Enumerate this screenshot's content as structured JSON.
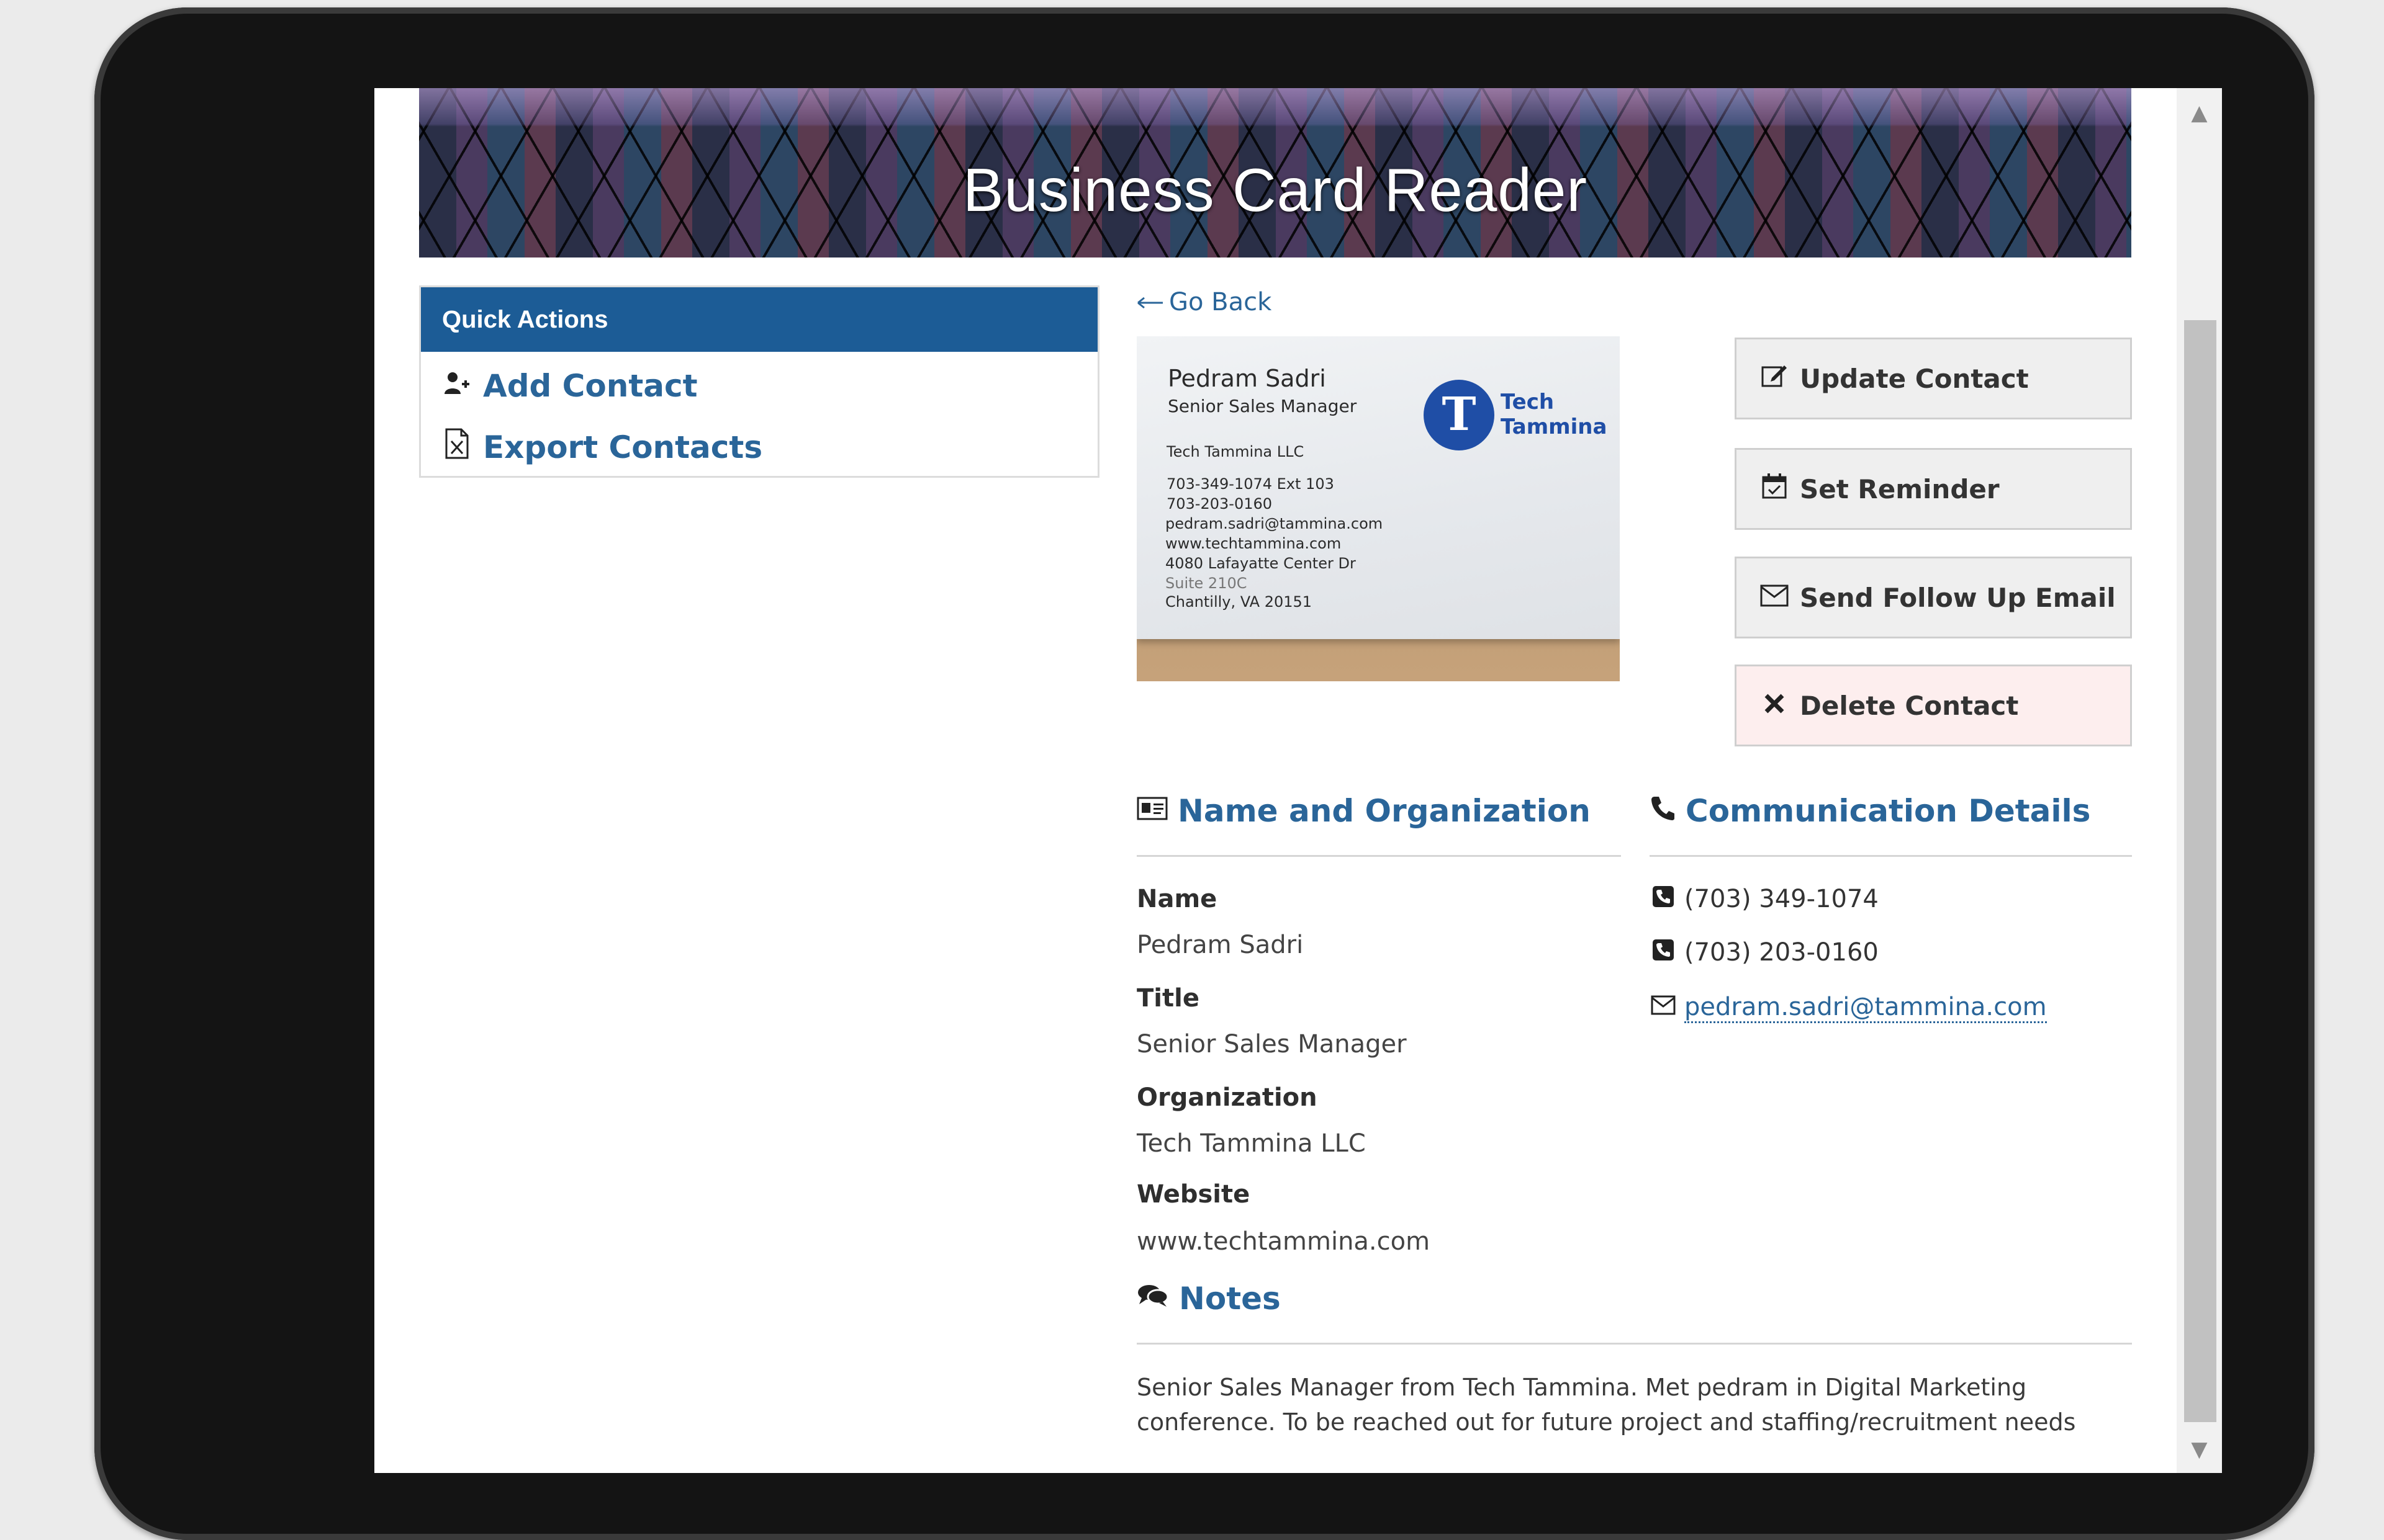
{
  "app": {
    "title": "Business Card Reader"
  },
  "quick_actions": {
    "header": "Quick Actions",
    "items": [
      {
        "label": "Add Contact",
        "icon": "user-plus-icon"
      },
      {
        "label": "Export Contacts",
        "icon": "file-excel-icon"
      }
    ]
  },
  "nav": {
    "go_back": "Go Back",
    "go_back_icon": "arrow-left-icon"
  },
  "card_image": {
    "name": "Pedram Sadri",
    "title": "Senior Sales Manager",
    "logo_line1": "Tech",
    "logo_line2": "Tammina",
    "company": "Tech Tammina LLC",
    "lines": [
      "703-349-1074 Ext 103",
      "703-203-0160",
      "pedram.sadri@tammina.com",
      "www.techtammina.com",
      "4080 Lafayatte Center Dr",
      "Suite 210C",
      "Chantilly, VA 20151"
    ]
  },
  "actions": [
    {
      "label": "Update Contact",
      "icon": "edit-icon"
    },
    {
      "label": "Set Reminder",
      "icon": "calendar-check-icon"
    },
    {
      "label": "Send Follow Up Email",
      "icon": "envelope-icon"
    },
    {
      "label": "Delete Contact",
      "icon": "close-icon"
    }
  ],
  "name_org": {
    "title": "Name and Organization",
    "icon": "id-card-icon",
    "fields": [
      {
        "label": "Name",
        "value": "Pedram Sadri"
      },
      {
        "label": "Title",
        "value": "Senior Sales Manager"
      },
      {
        "label": "Organization",
        "value": "Tech Tammina LLC"
      },
      {
        "label": "Website",
        "value": "www.techtammina.com"
      }
    ]
  },
  "communication": {
    "title": "Communication Details",
    "icon": "phone-icon",
    "phones": [
      "(703) 349-1074",
      "(703) 203-0160"
    ],
    "email": "pedram.sadri@tammina.com"
  },
  "notes": {
    "title": "Notes",
    "icon": "comments-icon",
    "text": "Senior Sales Manager from Tech Tammina. Met pedram in Digital Marketing conference. To be reached out for future project and staffing/recruitment needs"
  },
  "colors": {
    "accent": "#1c5c96",
    "link": "#2a6599",
    "danger_bg": "#fdeeee"
  }
}
